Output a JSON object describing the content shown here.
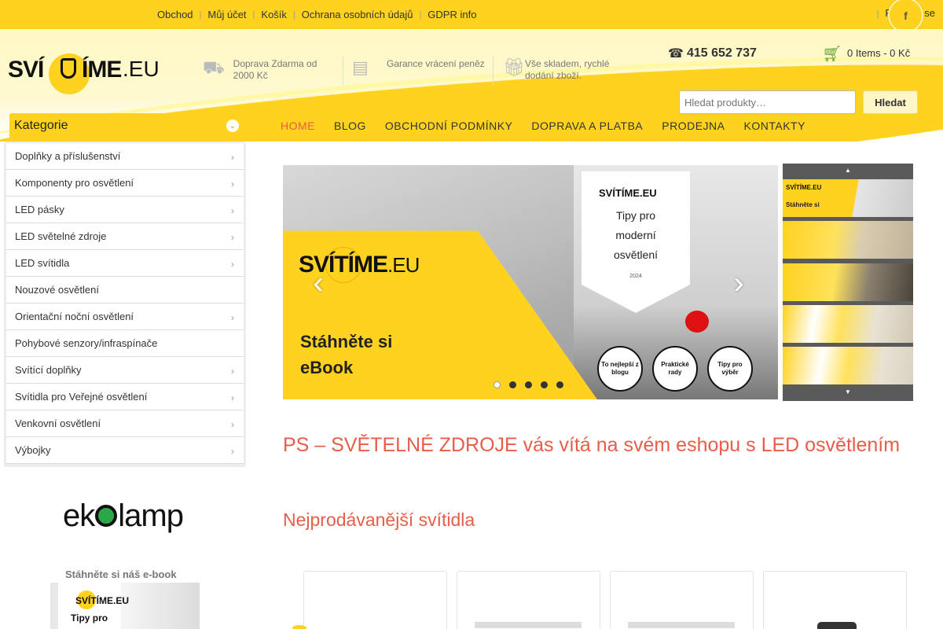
{
  "topnav": {
    "items": [
      "Obchod",
      "Můj účet",
      "Košík",
      "Ochrana osobních údajů",
      "GDPR info"
    ],
    "right_label": "Přihlásit se",
    "facebook_glyph": "f"
  },
  "header": {
    "logo": {
      "part1": "SVÍ",
      "part2": "ÍME",
      "part3": ".EU"
    },
    "features": [
      {
        "icon": "truck-icon",
        "text": "Doprava Zdarma od 2000 Kč"
      },
      {
        "icon": "money-icon",
        "text": "Garance vrácení peněz"
      },
      {
        "icon": "gift-icon",
        "text": "Vše skladem, rychlé dodání zboží."
      }
    ],
    "phone": "415 652 737",
    "cart": "0 Items - 0 Kč",
    "search": {
      "placeholder": "Hledat produkty…",
      "button": "Hledat"
    }
  },
  "categories": {
    "title": "Kategorie",
    "items": [
      {
        "label": "Doplňky a příslušenství",
        "has_sub": true
      },
      {
        "label": "Komponenty pro osvětlení",
        "has_sub": true
      },
      {
        "label": "LED pásky",
        "has_sub": true
      },
      {
        "label": "LED světelné zdroje",
        "has_sub": true
      },
      {
        "label": "LED svítidla",
        "has_sub": true
      },
      {
        "label": "Nouzové osvětlení",
        "has_sub": false
      },
      {
        "label": "Orientační noční osvětlení",
        "has_sub": true
      },
      {
        "label": "Pohybové senzory/infraspínače",
        "has_sub": false
      },
      {
        "label": "Svítící doplňky",
        "has_sub": true
      },
      {
        "label": "Svítidla pro Veřejné osvětlení",
        "has_sub": true
      },
      {
        "label": "Venkovní osvětlení",
        "has_sub": true
      },
      {
        "label": "Výbojky",
        "has_sub": true
      }
    ]
  },
  "mainnav": {
    "items": [
      "HOME",
      "BLOG",
      "OBCHODNÍ PODMÍNKY",
      "DOPRAVA A PLATBA",
      "PRODEJNA",
      "KONTAKTY"
    ],
    "active": "HOME"
  },
  "slider": {
    "logo": "SVÍTÍME",
    "logo_suffix": ".EU",
    "headline_line1": "Stáhněte si",
    "headline_line2": "eBook",
    "book": {
      "logo": "SVÍTÍME.EU",
      "title_line1": "Tipy pro",
      "title_line2": "moderní",
      "title_line3": "osvětlení",
      "year": "2024"
    },
    "badges": [
      "To nejlepší z blogu",
      "Praktické rady",
      "Tipy pro výběr"
    ],
    "dots": 5,
    "active_dot": 0,
    "prev": "‹",
    "next": "›",
    "thumb_label": "Stáhněte si",
    "thumb_logo": "SVÍTÍME.EU"
  },
  "main": {
    "title": "PS – SVĚTELNÉ ZDROJE vás vítá na svém eshopu s LED osvětlením",
    "section": "Nejprodávanější svítidla"
  },
  "sidebar": {
    "partner_logo_part1": "ek",
    "partner_logo_part2": "lamp",
    "ebook_label": "Stáhněte si náš e-book",
    "ebook_logo": "SVÍTÍME.EU",
    "ebook_title": "Tipy pro"
  },
  "colors": {
    "brand_yellow": "#ffd21f",
    "accent_red": "#e85d4a",
    "cart_green": "#5a9e2e"
  }
}
